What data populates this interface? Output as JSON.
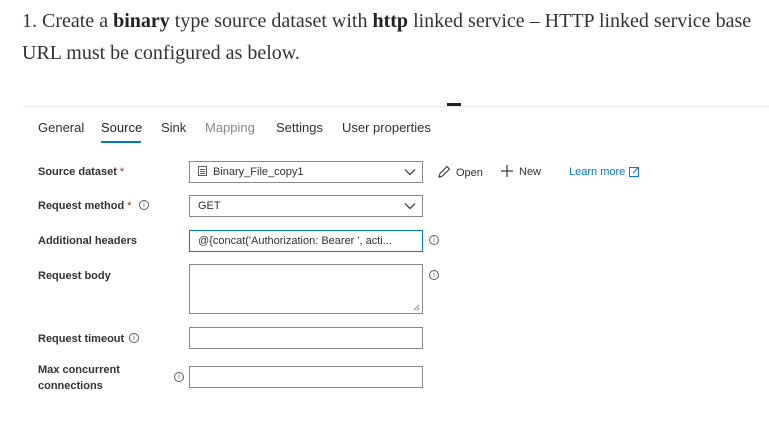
{
  "intro": {
    "t1": "1. Create a ",
    "b1": "binary",
    "t2": " type source dataset with ",
    "b2": "http",
    "t3": " linked service – HTTP linked service base URL must be configured as below."
  },
  "tabs": [
    {
      "label": "General",
      "state": "normal"
    },
    {
      "label": "Source",
      "state": "active"
    },
    {
      "label": "Sink",
      "state": "normal"
    },
    {
      "label": "Mapping",
      "state": "disabled"
    },
    {
      "label": "Settings",
      "state": "normal"
    },
    {
      "label": "User properties",
      "state": "normal"
    }
  ],
  "form": {
    "source_dataset": {
      "label": "Source dataset",
      "required_mark": "*",
      "value": "Binary_File_copy1",
      "icon": "dataset-file-icon"
    },
    "request_method": {
      "label": "Request method",
      "required_mark": "*",
      "value": "GET"
    },
    "additional_headers": {
      "label": "Additional headers",
      "value": "@{concat('Authorization: Bearer ', acti..."
    },
    "request_body": {
      "label": "Request body",
      "value": ""
    },
    "request_timeout": {
      "label": "Request timeout",
      "value": ""
    },
    "max_concurrent": {
      "label_line1": "Max concurrent",
      "label_line2": "connections",
      "value": ""
    }
  },
  "actions": {
    "open": "Open",
    "new": "New",
    "learn_more": "Learn more"
  },
  "colors": {
    "accent": "#0078d4",
    "required": "#a4262c",
    "border": "#8a8886",
    "text": "#323130"
  }
}
